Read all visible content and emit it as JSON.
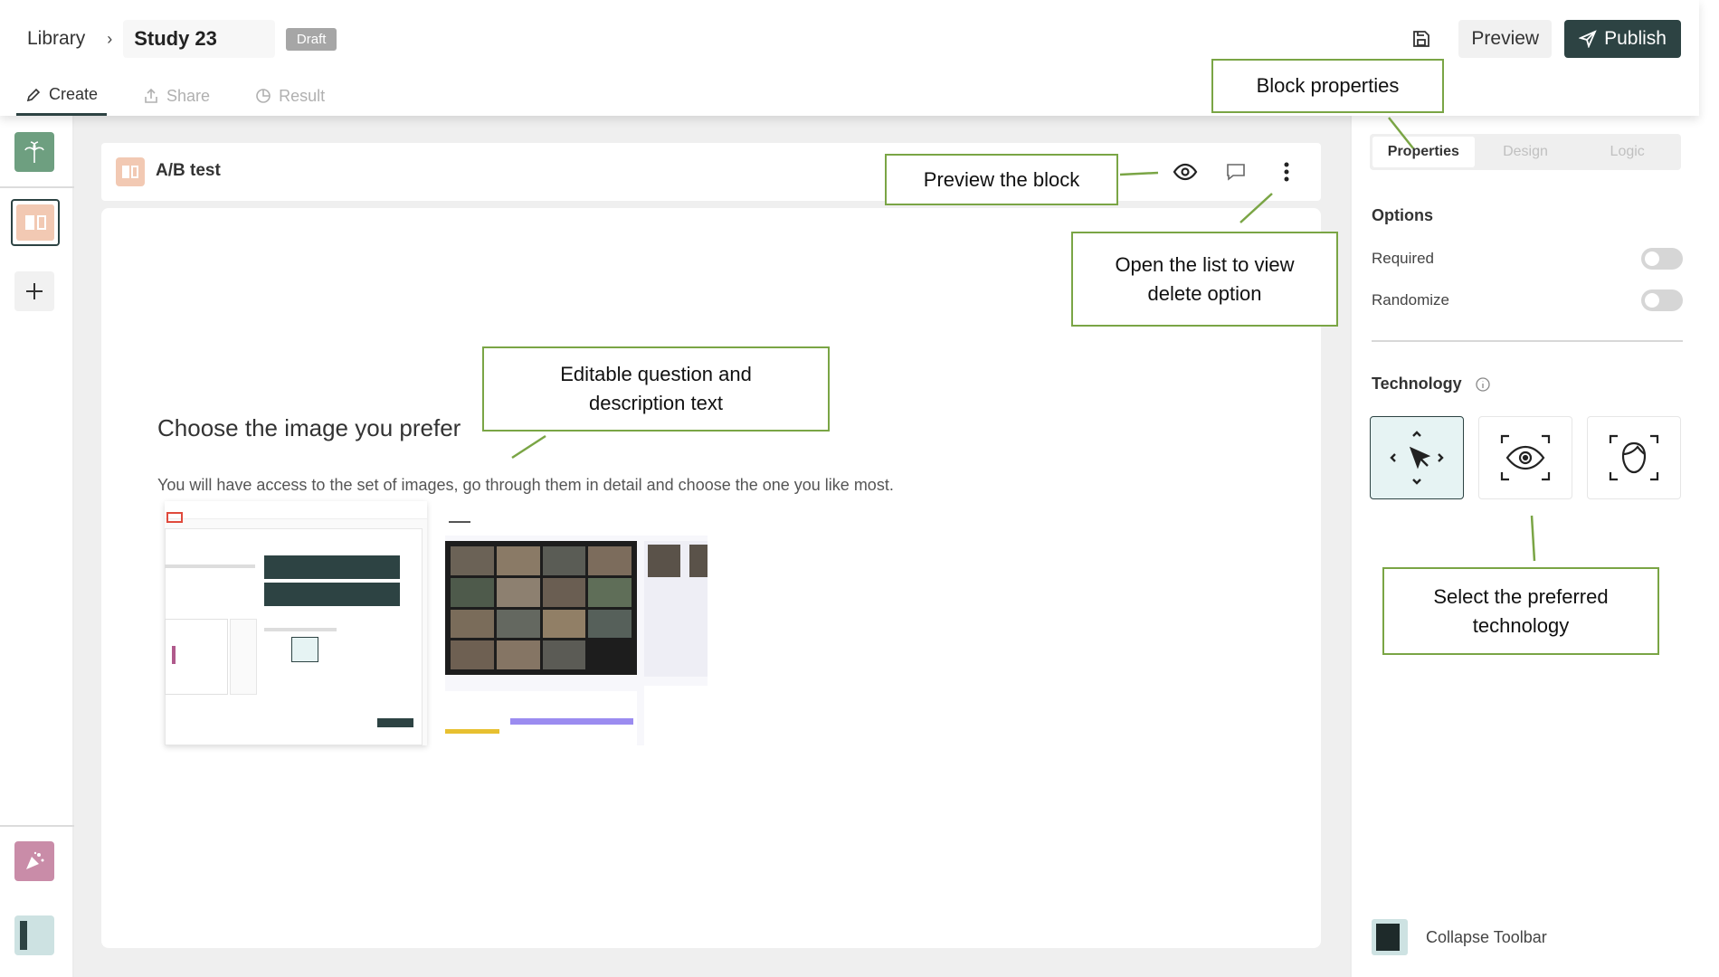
{
  "header": {
    "breadcrumb_root": "Library",
    "breadcrumb_sep": "›",
    "study_name": "Study 23",
    "status_badge": "Draft",
    "preview_label": "Preview",
    "publish_label": "Publish"
  },
  "tabs": [
    {
      "label": "Create",
      "icon": "pencil-icon",
      "active": true
    },
    {
      "label": "Share",
      "icon": "share-icon",
      "active": false
    },
    {
      "label": "Result",
      "icon": "pie-chart-icon",
      "active": false
    }
  ],
  "block": {
    "title": "A/B test",
    "question": "Choose the image you prefer",
    "description": "You will have access to the set of images, go through them in detail and choose the one you like most."
  },
  "panel": {
    "tabs": [
      {
        "label": "Properties",
        "active": true
      },
      {
        "label": "Design",
        "active": false
      },
      {
        "label": "Logic",
        "active": false
      }
    ],
    "options_title": "Options",
    "options": [
      {
        "label": "Required",
        "enabled": false
      },
      {
        "label": "Randomize",
        "enabled": false
      }
    ],
    "technology_title": "Technology",
    "technologies": [
      {
        "icon": "mouse-tracking-icon",
        "selected": true
      },
      {
        "icon": "eye-tracking-icon",
        "selected": false
      },
      {
        "icon": "face-tracking-icon",
        "selected": false
      }
    ],
    "collapse_label": "Collapse Toolbar"
  },
  "annotations": {
    "block_properties": "Block properties",
    "preview_block": "Preview the block",
    "open_list": "Open the list to view delete option",
    "editable_text": "Editable question and description text",
    "select_technology": "Select the preferred technology"
  },
  "colors": {
    "accent": "#2d4343",
    "callout_border": "#7aa545",
    "block_icon": "#f2c9b3"
  }
}
